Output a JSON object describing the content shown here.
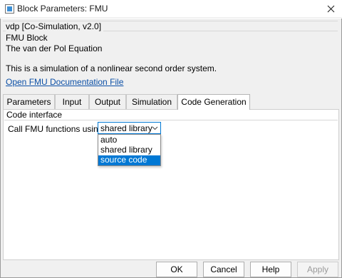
{
  "window": {
    "title": "Block Parameters: FMU"
  },
  "header": {
    "group_title": "vdp [Co-Simulation, v2.0]",
    "lines": [
      "FMU Block",
      "The van der Pol Equation"
    ],
    "description": "This is a simulation of a nonlinear second order system.",
    "doc_link": "Open FMU Documentation File"
  },
  "tabs": [
    {
      "label": "Parameters",
      "active": false
    },
    {
      "label": "Input",
      "active": false
    },
    {
      "label": "Output",
      "active": false
    },
    {
      "label": "Simulation",
      "active": false
    },
    {
      "label": "Code Generation",
      "active": true
    }
  ],
  "panel": {
    "section_title": "Code interface",
    "field_label": "Call FMU functions using:",
    "selected_value": "shared library",
    "options": [
      "auto",
      "shared library",
      "source code"
    ],
    "highlighted_option": "source code"
  },
  "buttons": {
    "ok": "OK",
    "cancel": "Cancel",
    "help": "Help",
    "apply": "Apply"
  },
  "colors": {
    "accent": "#0078d4",
    "link": "#0b4fa6"
  },
  "icons": [
    "app-icon",
    "close-icon",
    "chevron-down-icon"
  ]
}
